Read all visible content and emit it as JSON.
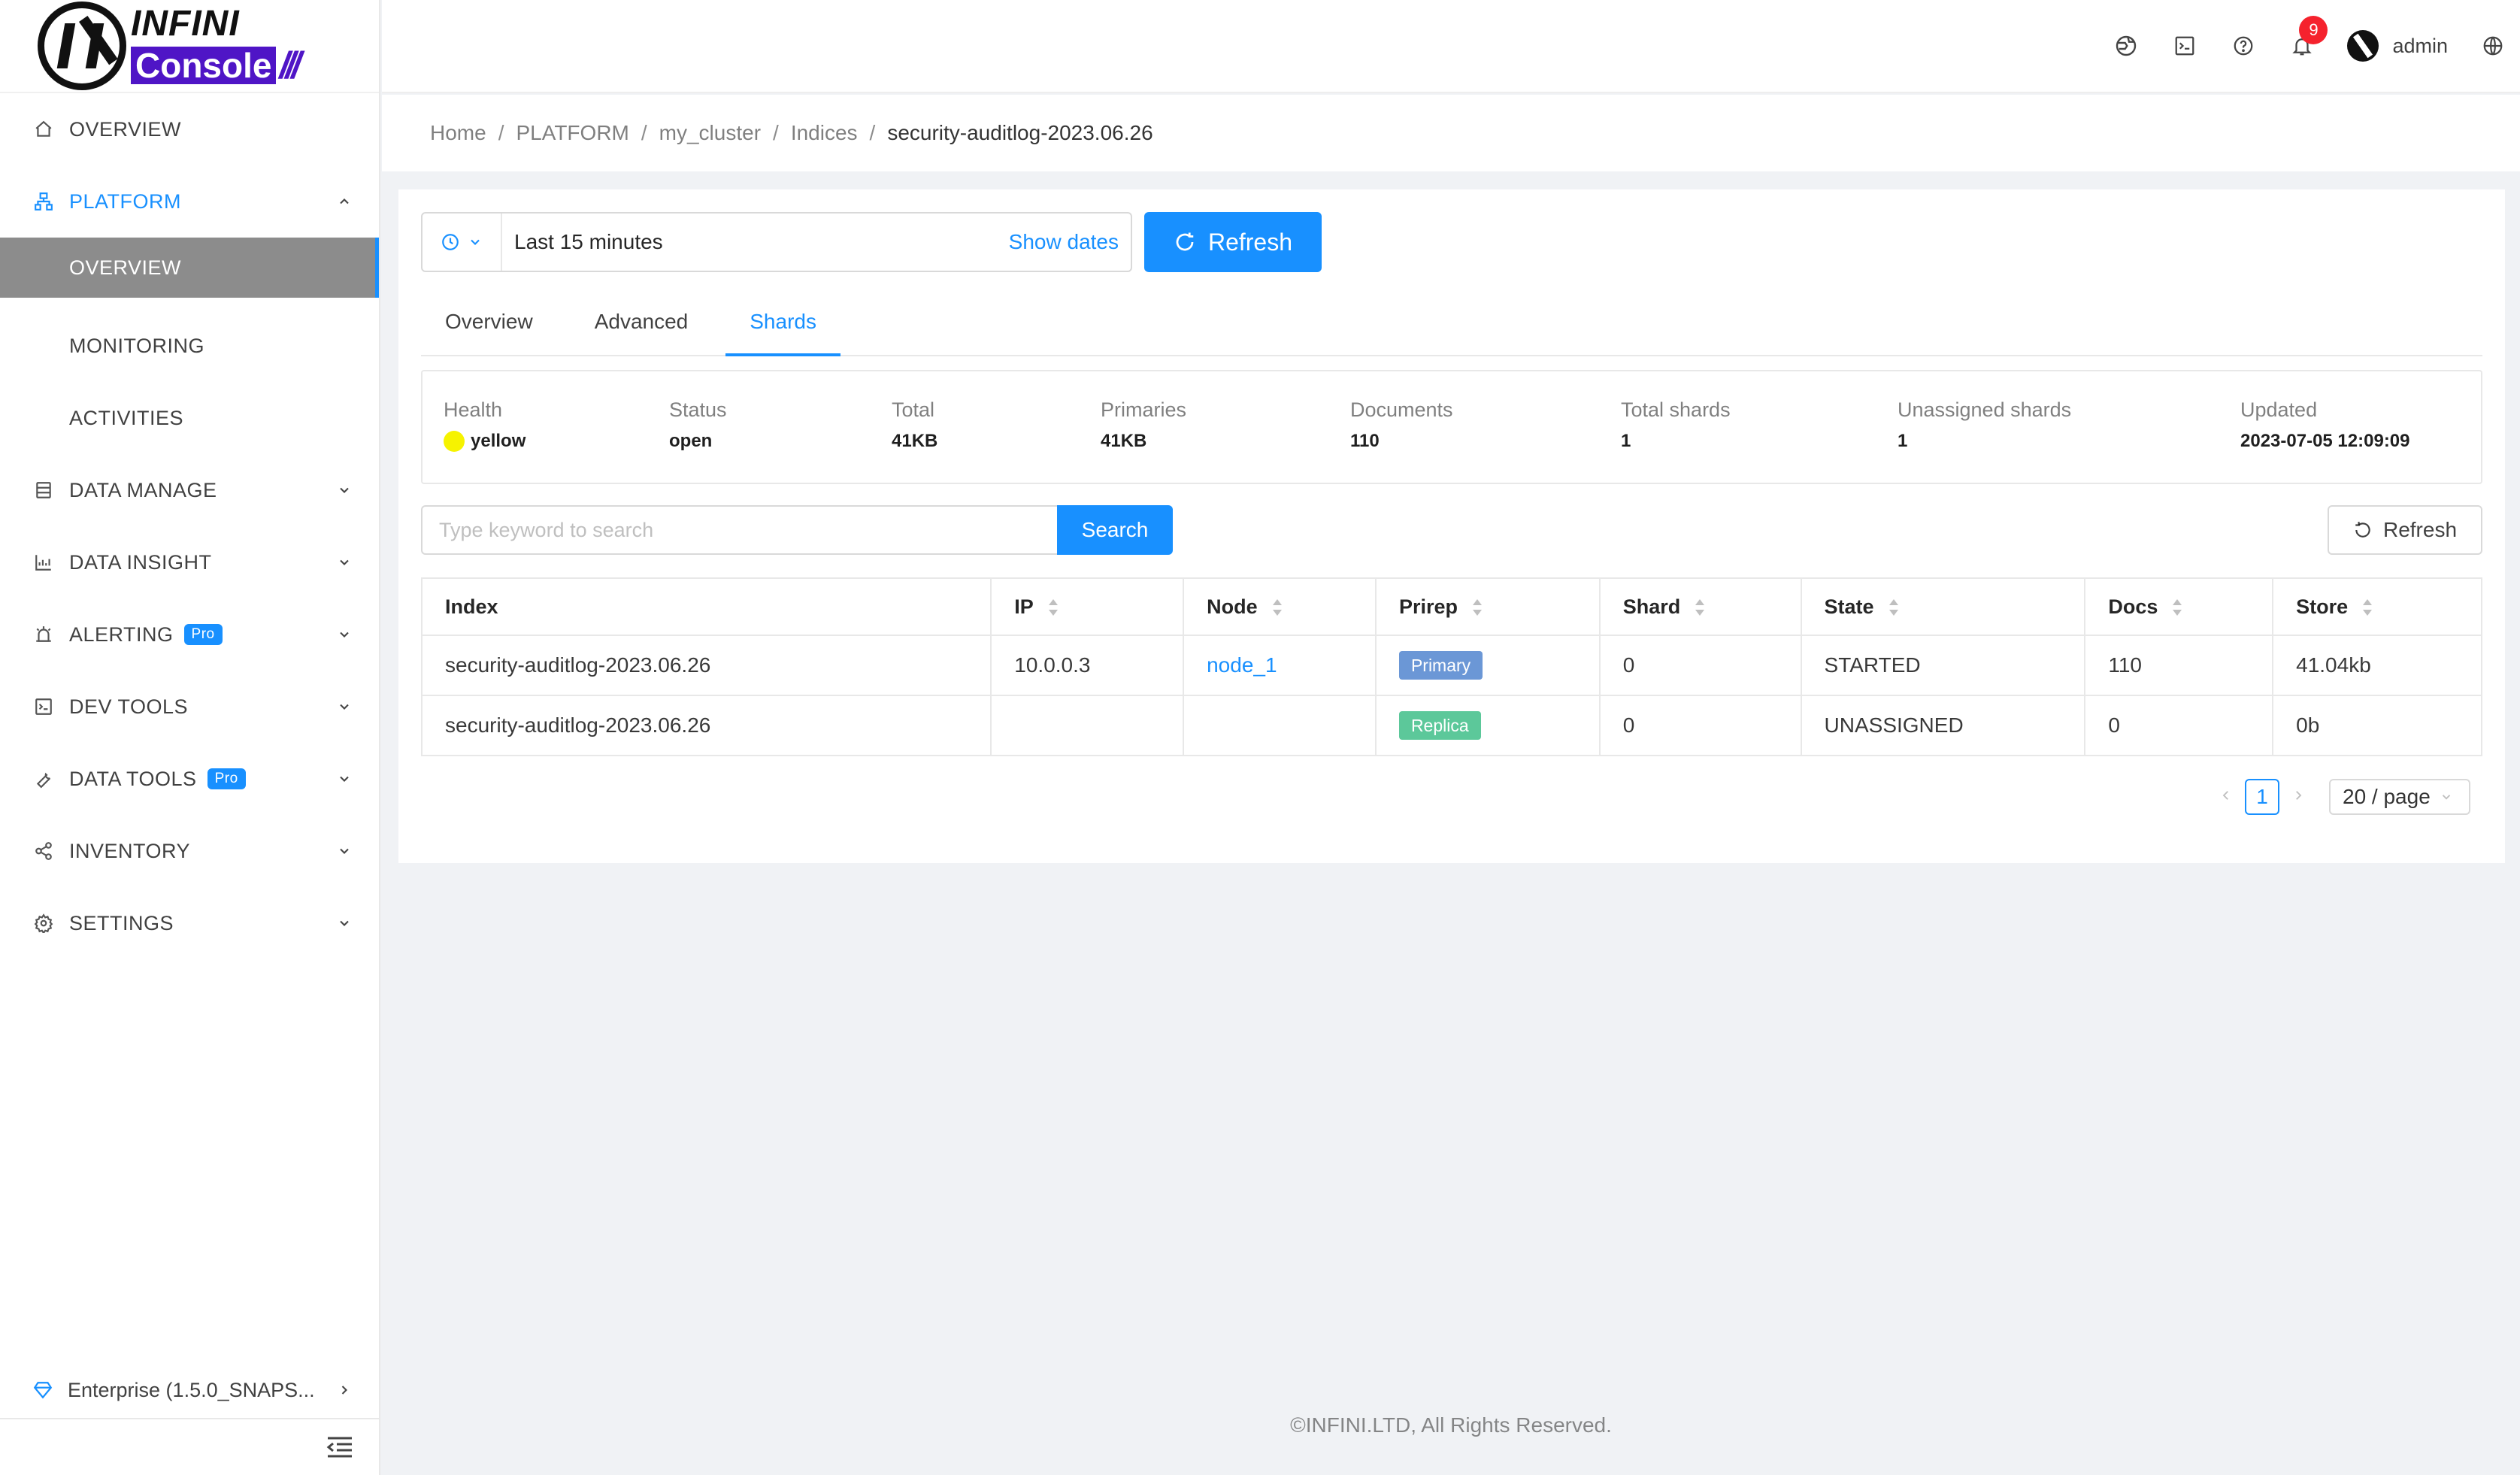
{
  "app": {
    "logo_top": "INFINI",
    "logo_bottom": "Console",
    "logo_slashes": "///"
  },
  "sidebar": {
    "items": [
      {
        "label": "OVERVIEW",
        "icon": "home-icon"
      },
      {
        "label": "PLATFORM",
        "icon": "cluster-icon",
        "expanded": true
      },
      {
        "label": "OVERVIEW",
        "selected": true
      },
      {
        "label": "MONITORING"
      },
      {
        "label": "ACTIVITIES"
      },
      {
        "label": "DATA MANAGE",
        "icon": "database-icon"
      },
      {
        "label": "DATA INSIGHT",
        "icon": "chart-icon"
      },
      {
        "label": "ALERTING",
        "icon": "alarm-icon",
        "badge": "Pro"
      },
      {
        "label": "DEV TOOLS",
        "icon": "terminal-icon"
      },
      {
        "label": "DATA TOOLS",
        "icon": "wrench-icon",
        "badge": "Pro"
      },
      {
        "label": "INVENTORY",
        "icon": "share-icon"
      },
      {
        "label": "SETTINGS",
        "icon": "gear-icon"
      }
    ],
    "edition": "Enterprise (1.5.0_SNAPS..."
  },
  "header": {
    "notification_count": "9",
    "username": "admin"
  },
  "breadcrumb": [
    "Home",
    "PLATFORM",
    "my_cluster",
    "Indices",
    "security-auditlog-2023.06.26"
  ],
  "toolbar": {
    "time_range": "Last 15 minutes",
    "show_dates": "Show dates",
    "refresh": "Refresh"
  },
  "tabs": [
    "Overview",
    "Advanced",
    "Shards"
  ],
  "active_tab": "Shards",
  "stats": {
    "health": {
      "label": "Health",
      "value": "yellow"
    },
    "status": {
      "label": "Status",
      "value": "open"
    },
    "total": {
      "label": "Total",
      "value": "41KB"
    },
    "primaries": {
      "label": "Primaries",
      "value": "41KB"
    },
    "documents": {
      "label": "Documents",
      "value": "110"
    },
    "total_shards": {
      "label": "Total shards",
      "value": "1"
    },
    "unassigned": {
      "label": "Unassigned shards",
      "value": "1"
    },
    "updated": {
      "label": "Updated",
      "value": "2023-07-05 12:09:09"
    }
  },
  "search": {
    "placeholder": "Type keyword to search",
    "button": "Search",
    "refresh": "Refresh"
  },
  "table": {
    "columns": [
      "Index",
      "IP",
      "Node",
      "Prirep",
      "Shard",
      "State",
      "Docs",
      "Store"
    ],
    "rows": [
      {
        "index": "security-auditlog-2023.06.26",
        "ip": "10.0.0.3",
        "node": "node_1",
        "prirep": "Primary",
        "shard": "0",
        "state": "STARTED",
        "docs": "110",
        "store": "41.04kb"
      },
      {
        "index": "security-auditlog-2023.06.26",
        "ip": "",
        "node": "",
        "prirep": "Replica",
        "shard": "0",
        "state": "UNASSIGNED",
        "docs": "0",
        "store": "0b"
      }
    ]
  },
  "pagination": {
    "current": "1",
    "page_size": "20 / page"
  },
  "footer": "©INFINI.LTD, All Rights Reserved.",
  "colors": {
    "primary": "#1890ff",
    "health_yellow": "#f6f300",
    "brand_purple": "#4f15c6"
  }
}
